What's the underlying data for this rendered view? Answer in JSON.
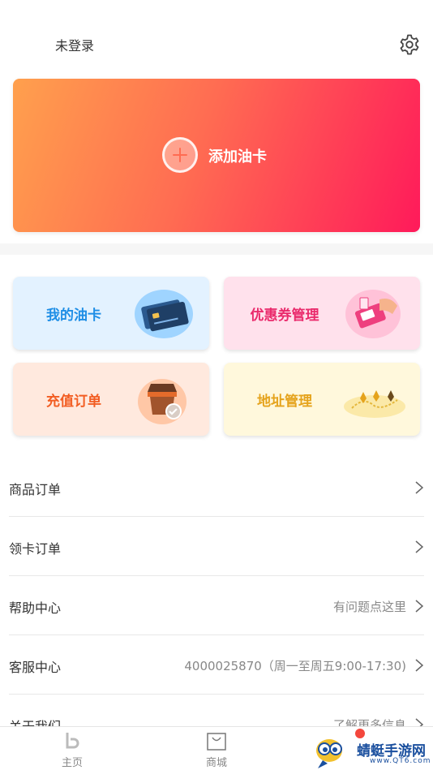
{
  "header": {
    "login_status": "未登录",
    "settings_icon": "gear-icon"
  },
  "banner": {
    "label": "添加油卡",
    "icon": "plus-circle-icon",
    "colors": [
      "#ffa04d",
      "#ff6c52",
      "#ff1a5a"
    ]
  },
  "cards": [
    {
      "label": "我的油卡",
      "color": "#1e8ee6",
      "icon": "credit-card-illustration"
    },
    {
      "label": "优惠券管理",
      "color": "#ea2b6c",
      "icon": "coupon-payment-illustration"
    },
    {
      "label": "充值订单",
      "color": "#f25d22",
      "icon": "shopping-basket-illustration"
    },
    {
      "label": "地址管理",
      "color": "#e5a31c",
      "icon": "map-route-illustration"
    }
  ],
  "list": [
    {
      "title": "商品订单",
      "value": ""
    },
    {
      "title": "领卡订单",
      "value": ""
    },
    {
      "title": "帮助中心",
      "value": "有问题点这里"
    },
    {
      "title": "客服中心",
      "value": "4000025870（周一至周五9:00-17:30)"
    },
    {
      "title": "关于我们",
      "value": "了解更多信息"
    }
  ],
  "tabbar": {
    "home_label": "主页",
    "mall_label": "商城"
  },
  "watermark": {
    "text": "蜻蜓手游网",
    "sub": "www.QT6.com"
  }
}
